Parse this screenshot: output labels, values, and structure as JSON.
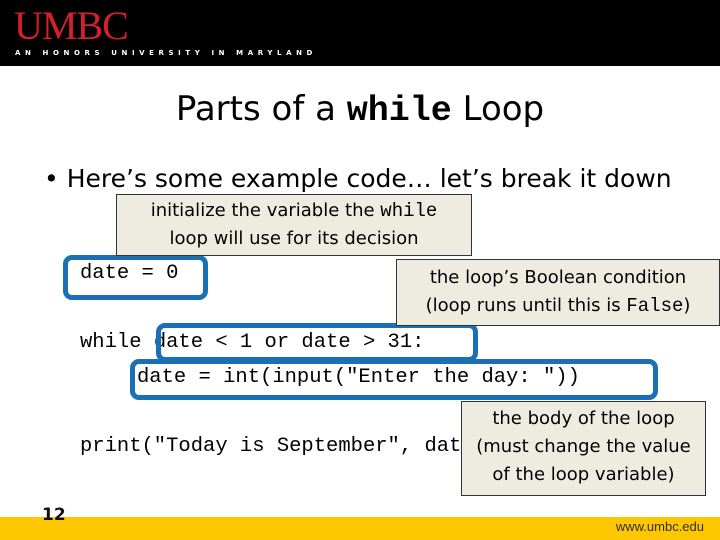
{
  "header": {
    "logo": "UMBC",
    "tagline": "AN HONORS UNIVERSITY IN MARYLAND",
    "logo_color": "#d4202c"
  },
  "slide": {
    "title_pre": "Parts of a",
    "title_code": "while",
    "title_post": "Loop",
    "bullet": "Here’s some example code… let’s break it down",
    "code_lines": {
      "init": "date = 0",
      "while_kw": "while ",
      "condition": "date < 1 or date > 31",
      "colon": ":",
      "body": "date = int(input(\"Enter the day: \"))",
      "print": "print(\"Today is September\", date)"
    },
    "callouts": {
      "init_line1_pre": "initialize the variable the ",
      "init_line1_code": "while",
      "init_line2": "loop will use for its decision",
      "cond_line1": "the loop’s Boolean condition",
      "cond_line2_pre": "(loop runs until this is ",
      "cond_line2_code": "False",
      "cond_line2_post": ")",
      "body_line1": "the body of the loop",
      "body_line2": "(must change the value",
      "body_line3": "of the loop variable)"
    },
    "highlight_color": "#1a6fb5",
    "callout_bg": "#eeece1"
  },
  "footer": {
    "slide_number": "12",
    "url": "www.umbc.edu",
    "bar_color": "#fdc800"
  }
}
